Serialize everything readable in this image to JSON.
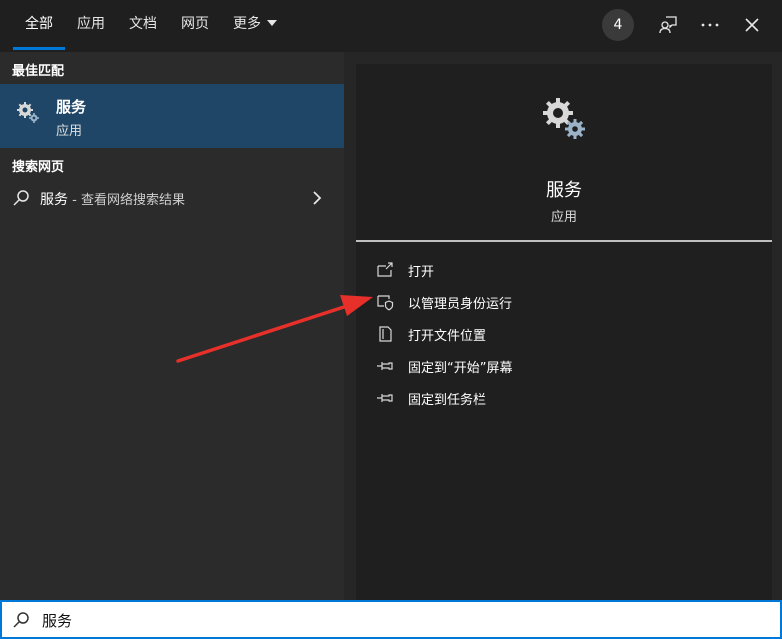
{
  "tabs": [
    {
      "label": "全部",
      "active": true
    },
    {
      "label": "应用",
      "active": false
    },
    {
      "label": "文档",
      "active": false
    },
    {
      "label": "网页",
      "active": false
    },
    {
      "label": "更多",
      "active": false,
      "has_dropdown": true
    }
  ],
  "header": {
    "badge_count": "4",
    "icons": [
      "feedback-icon",
      "more-icon",
      "close-icon"
    ]
  },
  "left": {
    "best_match_heading": "最佳匹配",
    "best_match": {
      "title": "服务",
      "subtitle": "应用",
      "icon": "services-gear-icon"
    },
    "web_heading": "搜索网页",
    "web_result": {
      "query": "服务",
      "suffix": " - 查看网络搜索结果",
      "icon": "search-icon"
    }
  },
  "detail": {
    "title": "服务",
    "subtitle": "应用",
    "actions": [
      {
        "label": "打开",
        "icon": "open-icon"
      },
      {
        "label": "以管理员身份运行",
        "icon": "admin-shield-icon"
      },
      {
        "label": "打开文件位置",
        "icon": "file-location-icon"
      },
      {
        "label": "固定到“开始”屏幕",
        "icon": "pin-icon"
      },
      {
        "label": "固定到任务栏",
        "icon": "pin-icon"
      }
    ]
  },
  "search": {
    "value": "服务"
  },
  "colors": {
    "accent": "#0078d7",
    "selection": "#1f4666",
    "annotation_arrow": "#e8302a"
  }
}
